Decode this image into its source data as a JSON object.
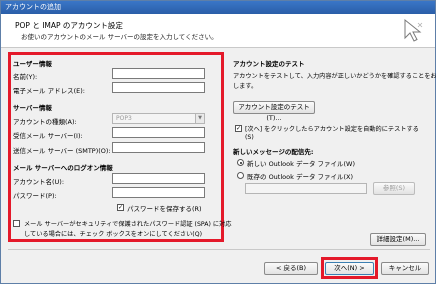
{
  "window": {
    "title": "アカウントの追加"
  },
  "header": {
    "title": "POP と IMAP のアカウント設定",
    "subtitle": "お使いのアカウントのメール サーバーの設定を入力してください。"
  },
  "user_info": {
    "section_label": "ユーザー情報",
    "name_label": "名前(Y):",
    "name_value": "",
    "email_label": "電子メール アドレス(E):",
    "email_value": ""
  },
  "server_info": {
    "section_label": "サーバー情報",
    "account_type_label": "アカウントの種類(A):",
    "account_type_value": "POP3",
    "incoming_label": "受信メール サーバー(I):",
    "incoming_value": "",
    "outgoing_label": "送信メール サーバー (SMTP)(O):",
    "outgoing_value": ""
  },
  "logon_info": {
    "section_label": "メール サーバーへのログオン情報",
    "account_name_label": "アカウント名(U):",
    "account_name_value": "",
    "password_label": "パスワード(P):",
    "password_value": "",
    "save_password_label": "パスワードを保存する(R)",
    "save_password_checked": true,
    "spa_label_line1": "メール サーバーがセキュリティで保護されたパスワード認証 (SPA) に対応",
    "spa_label_line2": "している場合には、チェック ボックスをオンにしてください(Q)",
    "spa_checked": false
  },
  "test": {
    "section_label": "アカウント設定のテスト",
    "description_line1": "アカウントをテストして、入力内容が正しいかどうかを確認することをお勧め",
    "description_line2": "します。",
    "test_button_label": "アカウント設定のテスト(T)...",
    "auto_test_label_line1": "[次へ] をクリックしたらアカウント設定を自動的にテストする",
    "auto_test_label_line2": "(S)",
    "auto_test_checked": true
  },
  "delivery": {
    "section_label": "新しいメッセージの配信先:",
    "option_new_label": "新しい Outlook データ ファイル(W)",
    "option_existing_label": "既存の Outlook データ ファイル(X)",
    "selected": "new",
    "existing_path_value": "",
    "browse_button_label": "参照(S)"
  },
  "buttons": {
    "more_settings_label": "詳細設定(M)...",
    "back_label": "< 戻る(B)",
    "next_label": "次へ(N) >",
    "cancel_label": "キャンセル"
  }
}
